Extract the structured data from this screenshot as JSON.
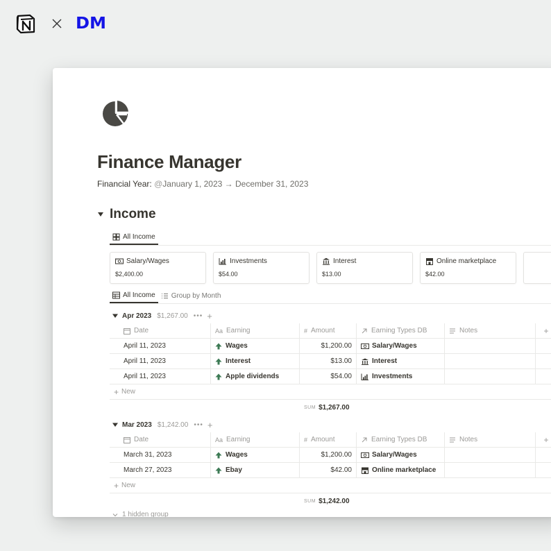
{
  "brand": {
    "times_symbol": "×",
    "partner_name": "DM"
  },
  "page": {
    "title": "Finance Manager",
    "financial_year_label": "Financial Year:",
    "financial_year_at": "@",
    "financial_year_value": "January 1, 2023 → December 31, 2023"
  },
  "section": {
    "title": "Income"
  },
  "view_tabs": [
    {
      "label": "All Income",
      "icon": "gallery-icon",
      "active": true
    }
  ],
  "cards": [
    {
      "title": "Salary/Wages",
      "value": "$2,400.00",
      "icon": "money-icon"
    },
    {
      "title": "Investments",
      "value": "$54.00",
      "icon": "chart-icon"
    },
    {
      "title": "Interest",
      "value": "$13.00",
      "icon": "bank-icon"
    },
    {
      "title": "Online marketplace",
      "value": "$42.00",
      "icon": "store-icon"
    }
  ],
  "table_tabs": [
    {
      "label": "All Income",
      "icon": "table-icon",
      "active": true
    },
    {
      "label": "Group by Month",
      "icon": "list-icon",
      "active": false
    }
  ],
  "columns": {
    "date": "Date",
    "earning_prefix": "Aa",
    "earning": "Earning",
    "amount_prefix": "#",
    "amount": "Amount",
    "type": "Earning Types DB",
    "notes": "Notes",
    "add": "+"
  },
  "groups": [
    {
      "name": "Apr 2023",
      "sum": "$1,267.00",
      "dots": "•••",
      "plus": "+",
      "rows": [
        {
          "date": "April 11, 2023",
          "earning": "Wages",
          "amount": "$1,200.00",
          "type": "Salary/Wages",
          "type_icon": "money-icon"
        },
        {
          "date": "April 11, 2023",
          "earning": "Interest",
          "amount": "$13.00",
          "type": "Interest",
          "type_icon": "bank-icon"
        },
        {
          "date": "April 11, 2023",
          "earning": "Apple dividends",
          "amount": "$54.00",
          "type": "Investments",
          "type_icon": "chart-icon"
        }
      ],
      "new_label": "New",
      "sum_label": "SUM",
      "sum_value": "$1,267.00"
    },
    {
      "name": "Mar 2023",
      "sum": "$1,242.00",
      "dots": "•••",
      "plus": "+",
      "rows": [
        {
          "date": "March 31, 2023",
          "earning": "Wages",
          "amount": "$1,200.00",
          "type": "Salary/Wages",
          "type_icon": "money-icon"
        },
        {
          "date": "March 27, 2023",
          "earning": "Ebay",
          "amount": "$42.00",
          "type": "Online marketplace",
          "type_icon": "store-icon"
        }
      ],
      "new_label": "New",
      "sum_label": "SUM",
      "sum_value": "$1,242.00"
    }
  ],
  "hidden_group_label": "1 hidden group",
  "colors": {
    "partner_brand": "#1414e6",
    "text": "#37352f",
    "muted": "#9b9a97",
    "arrow_green": "#3c7a54"
  }
}
